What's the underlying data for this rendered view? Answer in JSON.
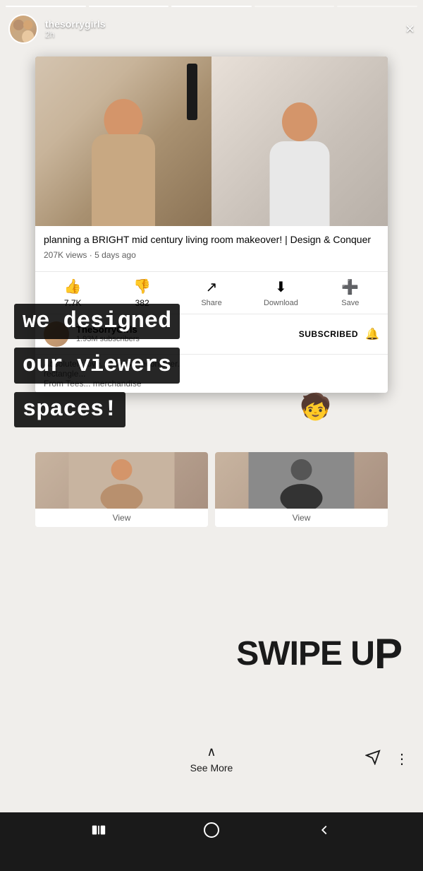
{
  "statusBar": {
    "time": ""
  },
  "story": {
    "progressBars": [
      "filled",
      "active",
      "empty",
      "empty",
      "empty"
    ],
    "username": "thesorrygirls",
    "timeAgo": "2h",
    "closeLabel": "×"
  },
  "youtubeCard": {
    "videoTitle": "planning a BRIGHT mid century living room makeover! | Design & Conquer",
    "viewCount": "207K views",
    "timeAgo": "5 days ago",
    "likeCount": "7.7K",
    "dislikeCount": "382",
    "shareLabel": "Share",
    "downloadLabel": "Download",
    "saveLabel": "Save",
    "channelName": "TheSorryGirls",
    "subscriberCount": "1.93M subscribers",
    "subscribedLabel": "SUBSCRIBED",
    "bellLabel": "🔔"
  },
  "overlay": {
    "line1": "we designed",
    "line2": "our viewers",
    "line3": "spaces!"
  },
  "swipeUp": {
    "text": "SWIPE U",
    "superP": "P"
  },
  "miniCards": [
    {
      "label": "View"
    },
    {
      "label": "View"
    }
  ],
  "storyBottom": {
    "chevron": "^",
    "seeMoreLabel": "See More",
    "sendIcon": "➤",
    "moreIcon": "⋮"
  },
  "navBar": {
    "menuIcon": "|||",
    "homeIcon": "○",
    "backIcon": "<"
  }
}
